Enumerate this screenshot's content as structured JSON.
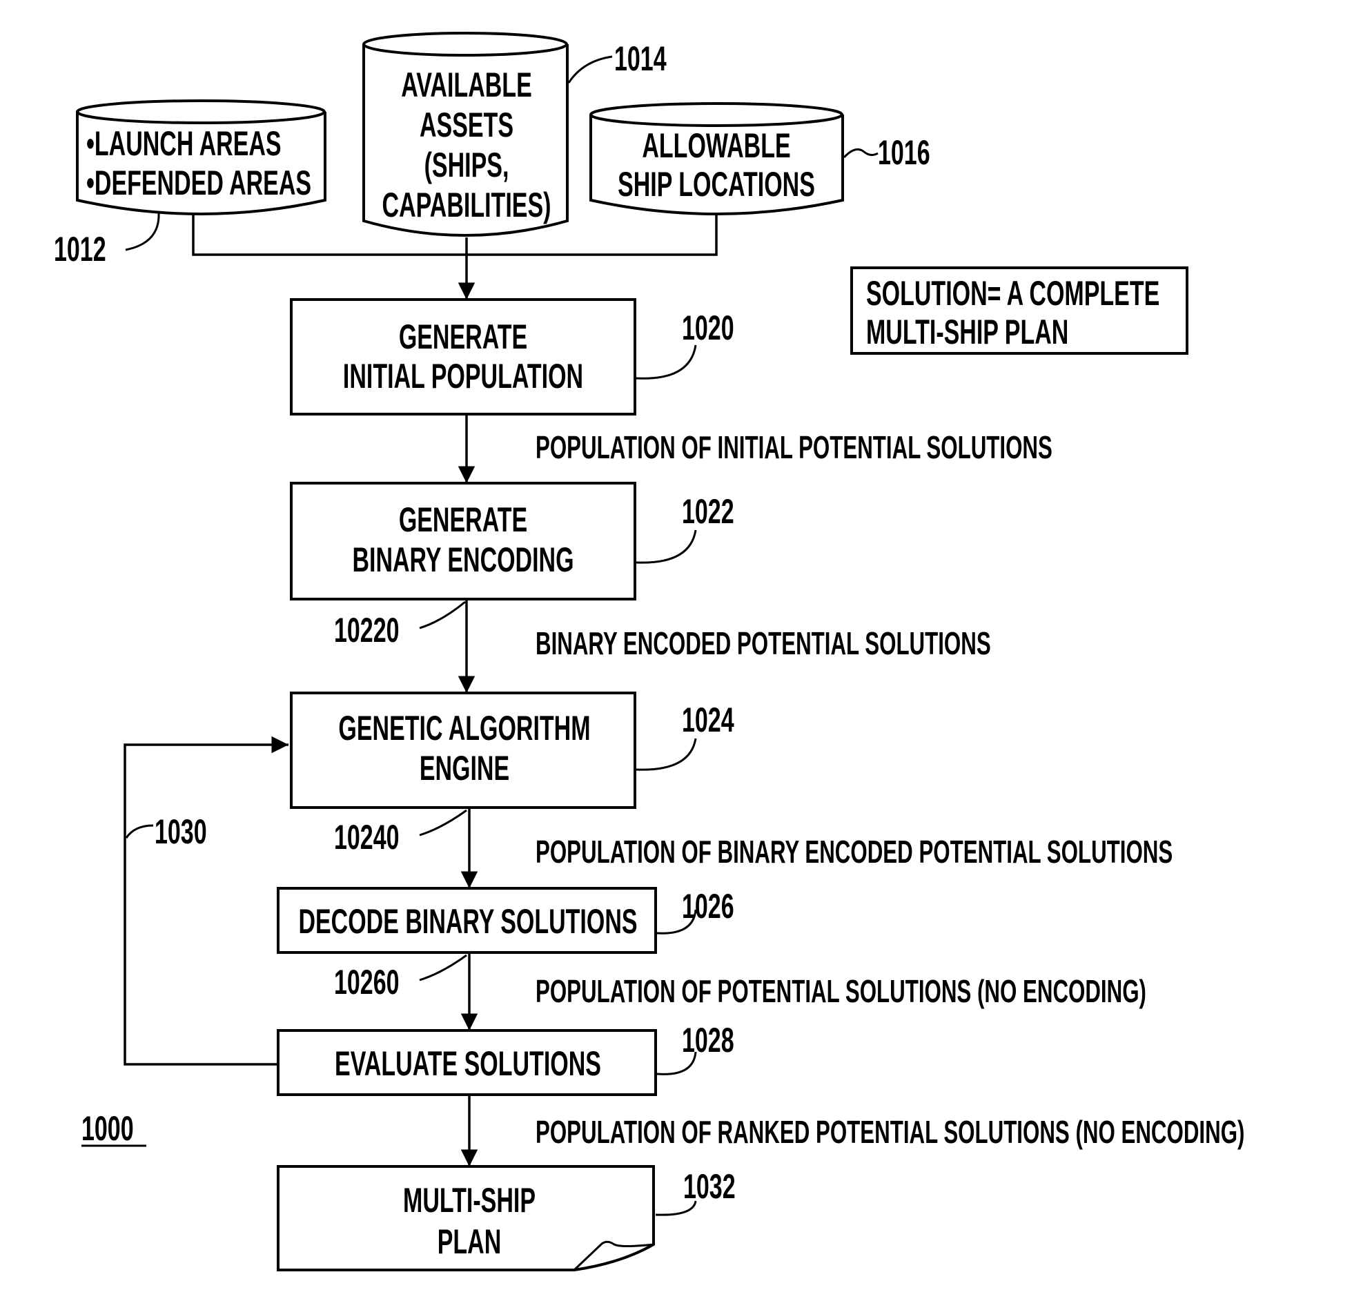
{
  "figure": {
    "id": "1000",
    "colors": {
      "ink": "#000000",
      "paper": "#ffffff"
    }
  },
  "inputs": [
    {
      "ref": "1012",
      "lines": [
        "•LAUNCH AREAS",
        "•DEFENDED AREAS"
      ]
    },
    {
      "ref": "1014",
      "lines": [
        "AVAILABLE",
        "ASSETS",
        "(SHIPS,",
        "CAPABILITIES)"
      ]
    },
    {
      "ref": "1016",
      "lines": [
        "ALLOWABLE",
        "SHIP LOCATIONS"
      ]
    }
  ],
  "note": {
    "lines": [
      "SOLUTION= A COMPLETE",
      "MULTI-SHIP PLAN"
    ]
  },
  "steps": [
    {
      "ref": "1020",
      "lines": [
        "GENERATE",
        "INITIAL POPULATION"
      ]
    },
    {
      "ref": "1022",
      "lines": [
        "GENERATE",
        "BINARY ENCODING"
      ]
    },
    {
      "ref": "1024",
      "lines": [
        "GENETIC ALGORITHM",
        "ENGINE"
      ]
    },
    {
      "ref": "1026",
      "lines": [
        "DECODE BINARY SOLUTIONS"
      ]
    },
    {
      "ref": "1028",
      "lines": [
        "EVALUATE SOLUTIONS"
      ]
    },
    {
      "ref": "1032",
      "lines": [
        "MULTI-SHIP",
        "PLAN"
      ]
    }
  ],
  "flows": [
    {
      "ref": "",
      "label": "POPULATION OF INITIAL POTENTIAL SOLUTIONS"
    },
    {
      "ref": "10220",
      "label": "BINARY ENCODED POTENTIAL SOLUTIONS"
    },
    {
      "ref": "10240",
      "label": "POPULATION OF BINARY ENCODED POTENTIAL SOLUTIONS"
    },
    {
      "ref": "10260",
      "label": "POPULATION OF POTENTIAL SOLUTIONS (NO ENCODING)"
    },
    {
      "ref": "",
      "label": "POPULATION OF RANKED POTENTIAL SOLUTIONS (NO ENCODING)"
    }
  ],
  "loop": {
    "ref": "1030"
  }
}
